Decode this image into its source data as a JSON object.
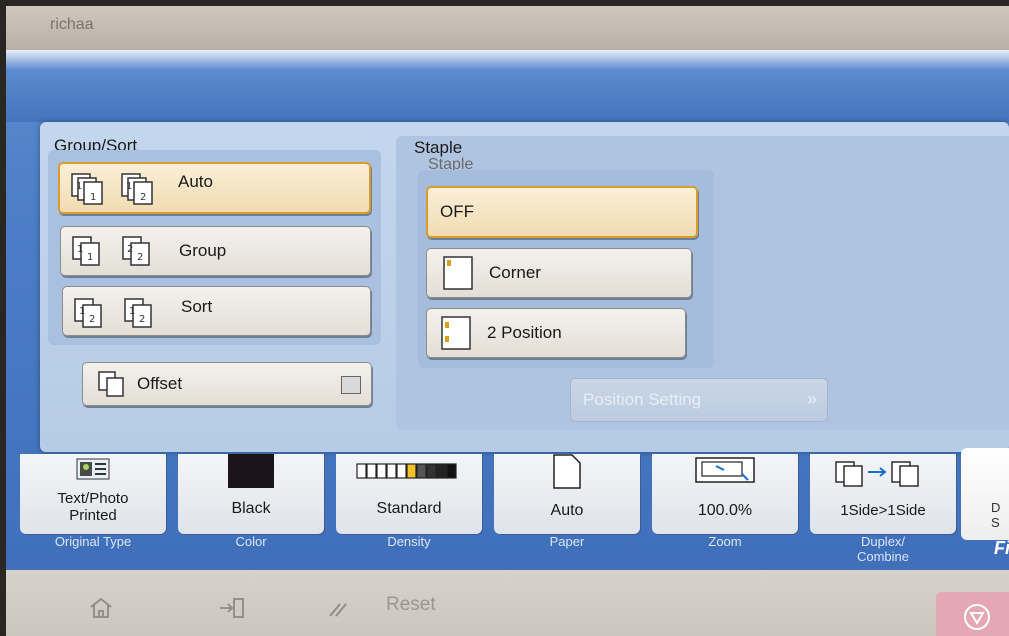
{
  "window": {
    "title": "richaa"
  },
  "group_sort": {
    "title": "Group/Sort",
    "options": [
      {
        "label": "Auto",
        "selected": true
      },
      {
        "label": "Group",
        "selected": false
      },
      {
        "label": "Sort",
        "selected": false
      }
    ],
    "offset": {
      "label": "Offset",
      "checked": false
    }
  },
  "staple": {
    "title": "Staple",
    "subtitle": "Staple",
    "options": [
      {
        "label": "OFF",
        "selected": true
      },
      {
        "label": "Corner",
        "selected": false
      },
      {
        "label": "2 Position",
        "selected": false
      }
    ],
    "position_setting": {
      "label": "Position Setting",
      "enabled": false,
      "arrow": "»"
    }
  },
  "function_bar": [
    {
      "value": "Text/Photo\nPrinted",
      "caption": "Original Type",
      "icon": "original-type-icon"
    },
    {
      "value": "Black",
      "caption": "Color",
      "icon": "color-swatch-icon"
    },
    {
      "value": "Standard",
      "caption": "Density",
      "icon": "density-scale-icon"
    },
    {
      "value": "Auto",
      "caption": "Paper",
      "icon": "paper-icon"
    },
    {
      "value": "100.0%",
      "caption": "Zoom",
      "icon": "zoom-icon"
    },
    {
      "value": "1Side>1Side",
      "caption": "Duplex/\nCombine",
      "icon": "duplex-icon"
    }
  ],
  "right_tab": {
    "text": "D\nS",
    "label": "Fi"
  },
  "footer": {
    "home_icon": "home-icon",
    "login_icon": "login-icon",
    "reset_label": "Reset",
    "stop_icon": "stop-icon"
  },
  "colors": {
    "selected_border": "#d79c2d",
    "panel_bg": "#c3d6ee",
    "screen_blue": "#4c7dc6"
  }
}
